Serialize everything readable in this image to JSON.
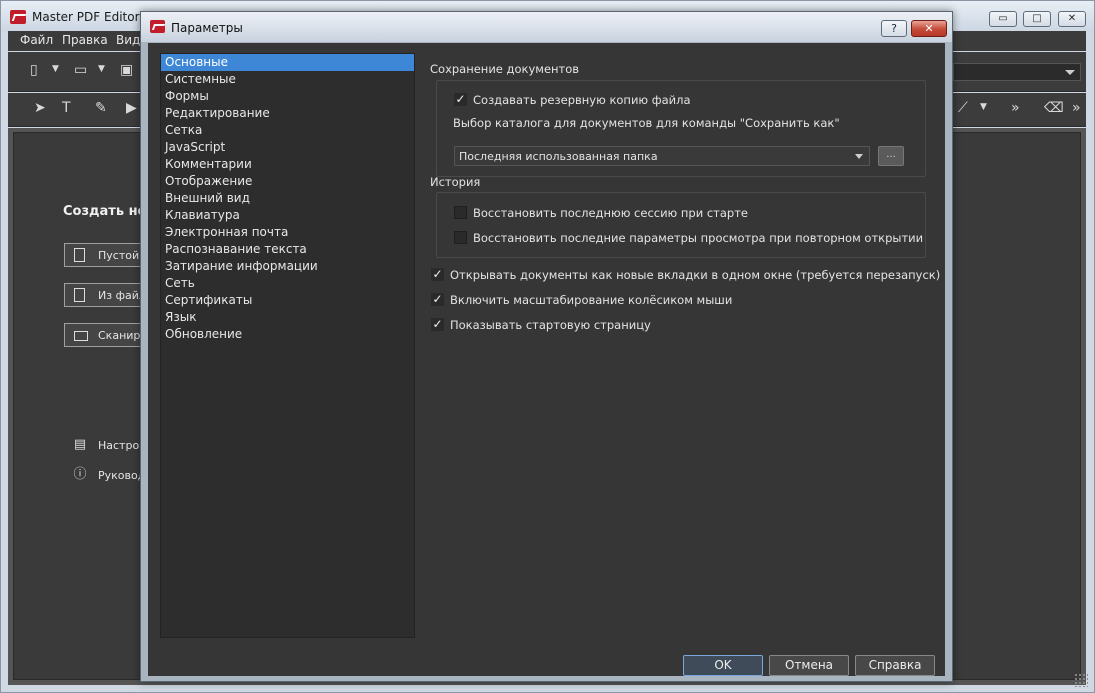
{
  "app": {
    "title": "Master PDF Editor",
    "window_controls": [
      "▭",
      "□",
      "✕"
    ],
    "menu": [
      "Файл",
      "Правка",
      "Вид"
    ],
    "start": {
      "heading": "Создать нов",
      "buttons": [
        "Пустой д",
        "Из файл",
        "Сканиро"
      ],
      "links": [
        "Настрой",
        "Руковод"
      ]
    }
  },
  "dialog": {
    "title": "Параметры",
    "help_glyph": "?",
    "close_glyph": "✕",
    "categories": [
      "Основные",
      "Системные",
      "Формы",
      "Редактирование",
      "Сетка",
      "JavaScript",
      "Комментарии",
      "Отображение",
      "Внешний вид",
      "Клавиатура",
      "Электронная почта",
      "Распознавание текста",
      "Затирание информации",
      "Сеть",
      "Сертификаты",
      "Язык",
      "Обновление"
    ],
    "selected_category": "Основные",
    "save_section": {
      "title": "Сохранение документов",
      "backup_label": "Создавать резервную копию файла",
      "backup_checked": true,
      "folder_prompt": "Выбор каталога для документов для команды \"Сохранить как\"",
      "folder_value": "Последняя использованная папка",
      "browse_label": "..."
    },
    "history_section": {
      "title": "История",
      "restore_session_label": "Восстановить последнюю сессию при старте",
      "restore_session_checked": false,
      "restore_view_label": "Восстановить последние параметры просмотра при повторном открытии",
      "restore_view_checked": false
    },
    "options": [
      {
        "label": "Открывать документы как новые вкладки в одном окне (требуется перезапуск)",
        "checked": true
      },
      {
        "label": "Включить масштабирование колёсиком мыши",
        "checked": true
      },
      {
        "label": "Показывать стартовую страницу",
        "checked": true
      }
    ],
    "buttons": {
      "ok": "OK",
      "cancel": "Отмена",
      "help": "Справка"
    },
    "check_glyph": "✓"
  }
}
